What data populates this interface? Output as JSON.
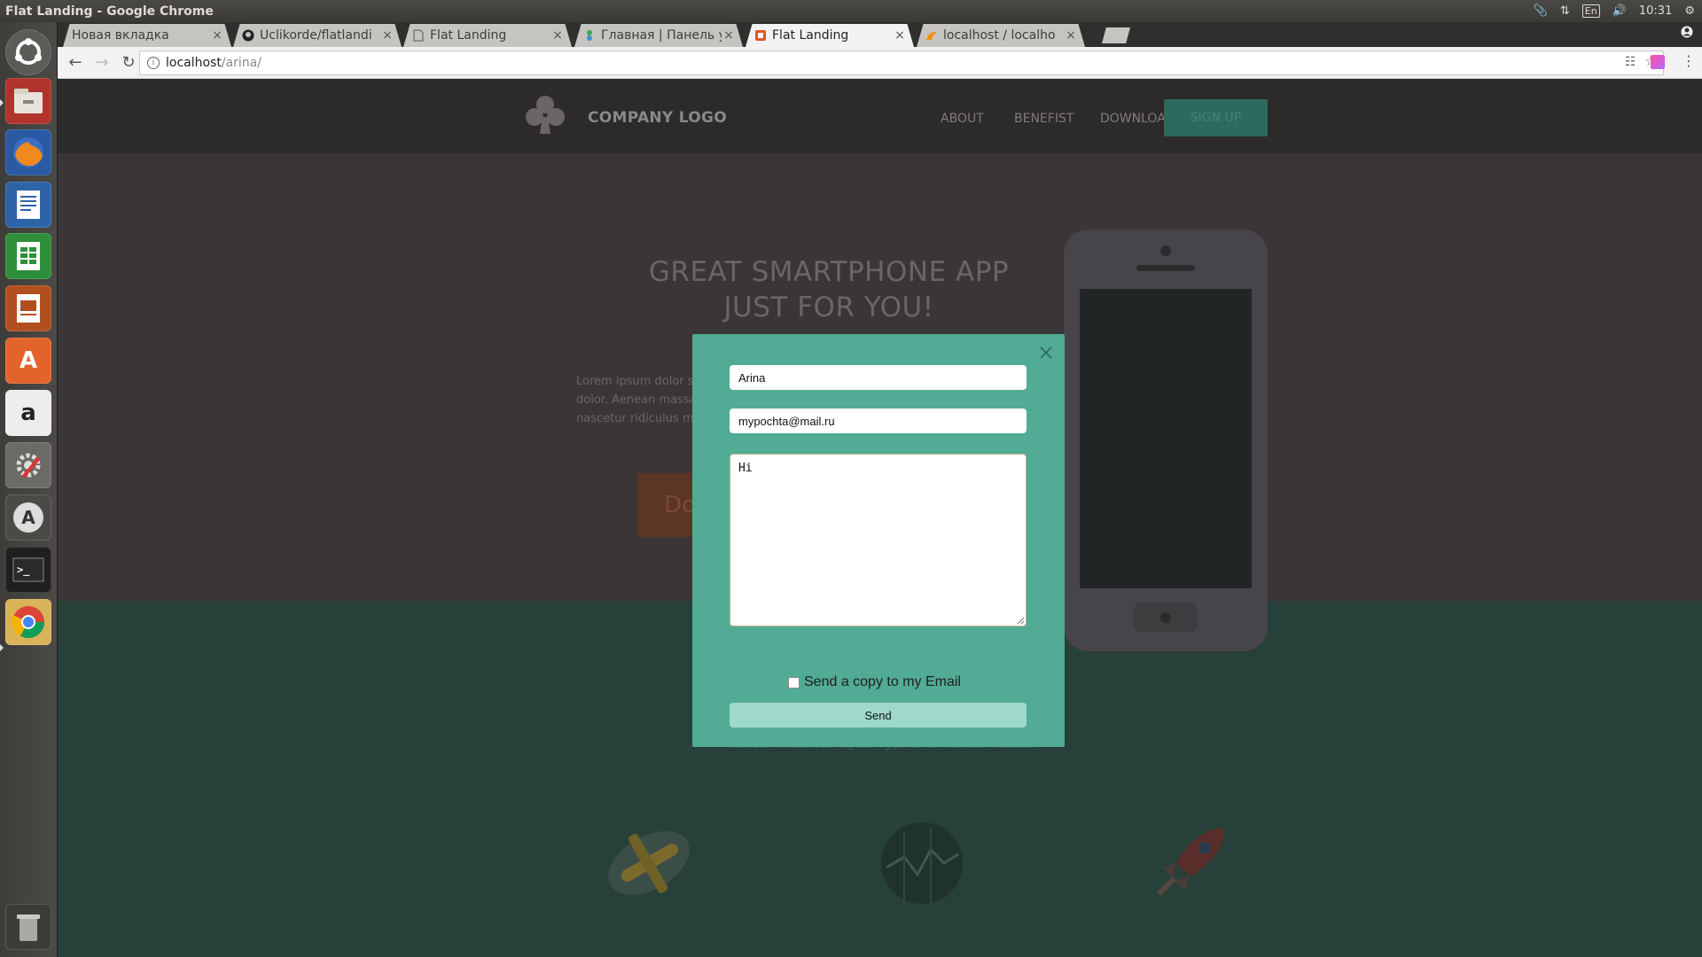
{
  "system": {
    "window_title": "Flat Landing - Google Chrome",
    "keyboard_layout": "En",
    "clock": "10:31"
  },
  "tabs": [
    {
      "label": "Новая вкладка",
      "icon": "blank-tab-icon"
    },
    {
      "label": "Uclikorde/flatlandi",
      "icon": "github-icon"
    },
    {
      "label": "Flat Landing",
      "icon": "page-icon"
    },
    {
      "label": "Главная | Панель у",
      "icon": "wordpress-like-icon"
    },
    {
      "label": "Flat Landing",
      "icon": "html-icon",
      "active": true
    },
    {
      "label": "localhost / localho",
      "icon": "phpmyadmin-icon"
    }
  ],
  "address_bar": {
    "host": "localhost",
    "path": "/arina/"
  },
  "site": {
    "logo_text": "COMPANY LOGO",
    "nav": [
      "ABOUT",
      "BENEFIST",
      "DOWNLOAD"
    ],
    "signup_label": "SIGN UP",
    "hero_title_line1": "GREAT SMARTPHONE APP",
    "hero_title_line2": "JUST FOR YOU!",
    "hero_text": "Lorem ipsum dolor sit amet, eget dolor. Aenean massa. C montes, nascetur ridiculus m",
    "download_label": "Do",
    "features_text": "Lorem ipsum dolor sit amet, consectetuer adipiscing elit. Aenean commodo ligula eget dolor. Aenean massa."
  },
  "modal": {
    "name_value": "Arina",
    "email_value": "mypochta@mail.ru",
    "message_value": "Hi",
    "copy_label": "Send a copy to my Email",
    "copy_checked": false,
    "send_label": "Send"
  },
  "colors": {
    "modal_bg": "#52ab94",
    "send_button": "#9ed9c9",
    "header_bg": "#2d2a2b",
    "hero_bg": "#3a3537",
    "features_bg": "#274039"
  }
}
